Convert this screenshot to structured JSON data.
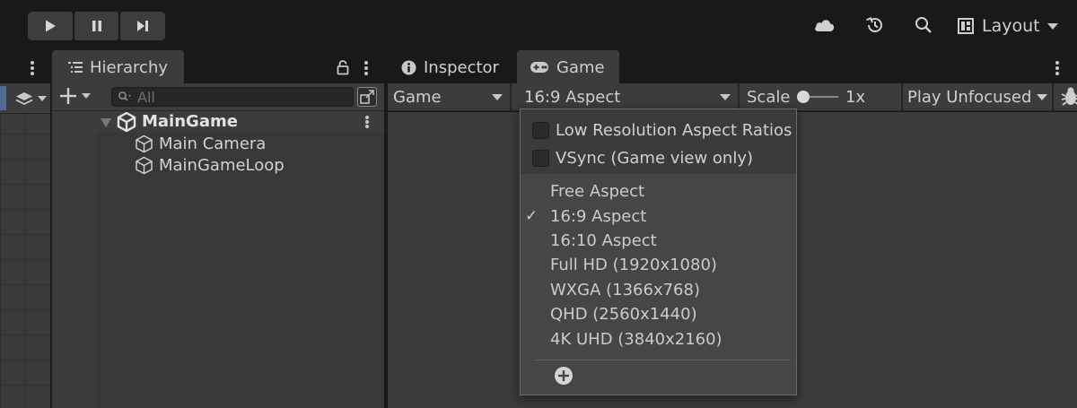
{
  "layout_label": "Layout",
  "tabs": {
    "hierarchy": "Hierarchy",
    "inspector": "Inspector",
    "game": "Game"
  },
  "hierarchy": {
    "search_placeholder": "All",
    "scene": "MainGame",
    "items": [
      "Main Camera",
      "MainGameLoop"
    ]
  },
  "game_toolbar": {
    "display": "Game",
    "aspect": "16:9 Aspect",
    "scale_label": "Scale",
    "scale_value": "1x",
    "play_mode": "Play Unfocused"
  },
  "aspect_menu": {
    "checkboxes": [
      "Low Resolution Aspect Ratios",
      "VSync (Game view only)"
    ],
    "options": [
      "Free Aspect",
      "16:9 Aspect",
      "16:10 Aspect",
      "Full HD (1920x1080)",
      "WXGA (1366x768)",
      "QHD (2560x1440)",
      "4K UHD (3840x2160)"
    ],
    "selected_mark": "✓"
  }
}
